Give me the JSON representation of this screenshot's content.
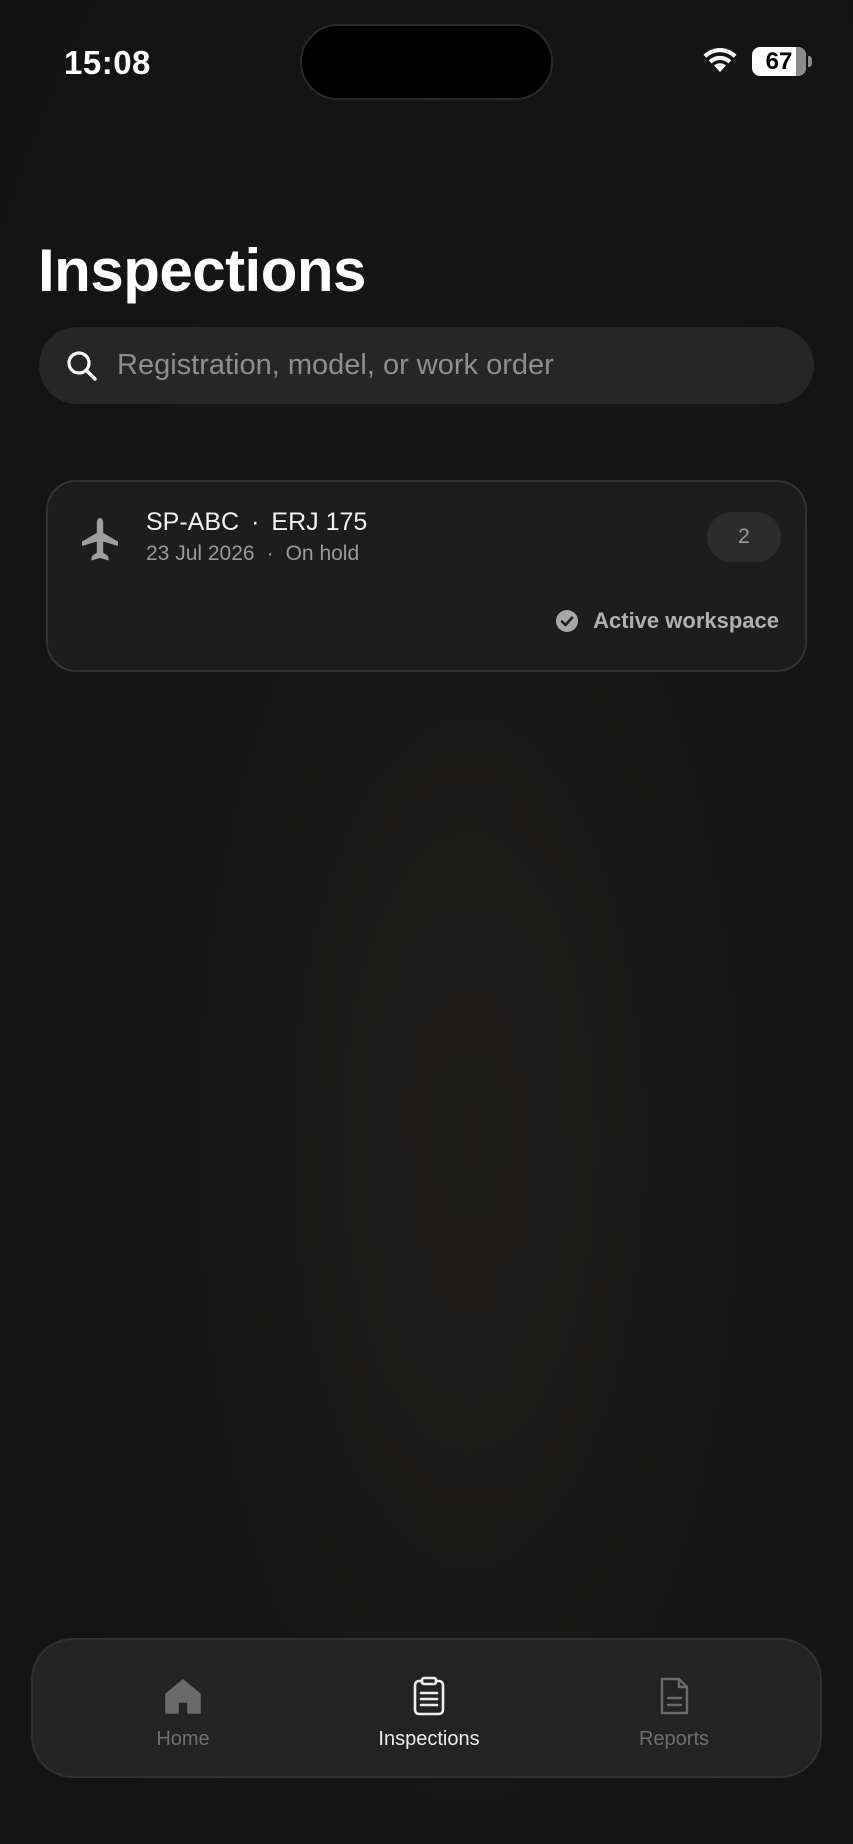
{
  "status_bar": {
    "time": "15:08",
    "battery": "67"
  },
  "page": {
    "title": "Inspections"
  },
  "search": {
    "placeholder": "Registration, model, or work order",
    "icon": "search-icon"
  },
  "inspections": [
    {
      "icon": "airplane-icon",
      "registration": "SP-ABC",
      "model": "ERJ 175",
      "date": "23 Jul 2026",
      "status": "On hold",
      "count": "2",
      "workspace_label": "Active workspace"
    }
  ],
  "tab_bar": {
    "items": [
      {
        "label": "Home",
        "icon": "home-icon",
        "active": false
      },
      {
        "label": "Inspections",
        "icon": "clipboard-icon",
        "active": true
      },
      {
        "label": "Reports",
        "icon": "document-icon",
        "active": false
      }
    ]
  },
  "colors": {
    "background": "#131313",
    "card": "#1d1d1d",
    "active_tab": "#ededed",
    "inactive_tab": "#6f6f6f"
  }
}
